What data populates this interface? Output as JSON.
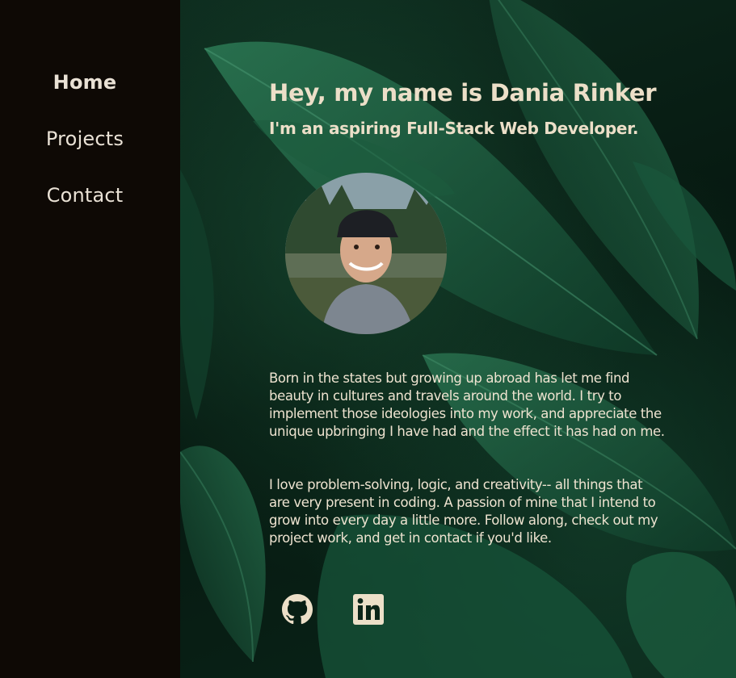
{
  "nav": {
    "items": [
      {
        "label": "Home"
      },
      {
        "label": "Projects"
      },
      {
        "label": "Contact"
      }
    ]
  },
  "hero": {
    "title": "Hey, my name is Dania Rinker",
    "subtitle": "I'm an aspiring Full-Stack Web Developer."
  },
  "about": {
    "paragraph_1": "Born in the states but growing up abroad has let me find beauty in cultures and travels around the world. I try to implement those ideologies into my work, and appreciate the unique upbringing I have had and the effect it has had on me.",
    "paragraph_2": "I love problem-solving, logic, and creativity-- all things that are very present in coding. A passion of mine that I intend to grow into every day a little more. Follow along, check out my project work, and get in contact if you'd like."
  },
  "social": {
    "icons": [
      "github-icon",
      "linkedin-icon"
    ]
  },
  "colors": {
    "sidebar_bg": "#0e0905",
    "text": "#ecdfc8",
    "leaf_green": "#1f6a47"
  }
}
